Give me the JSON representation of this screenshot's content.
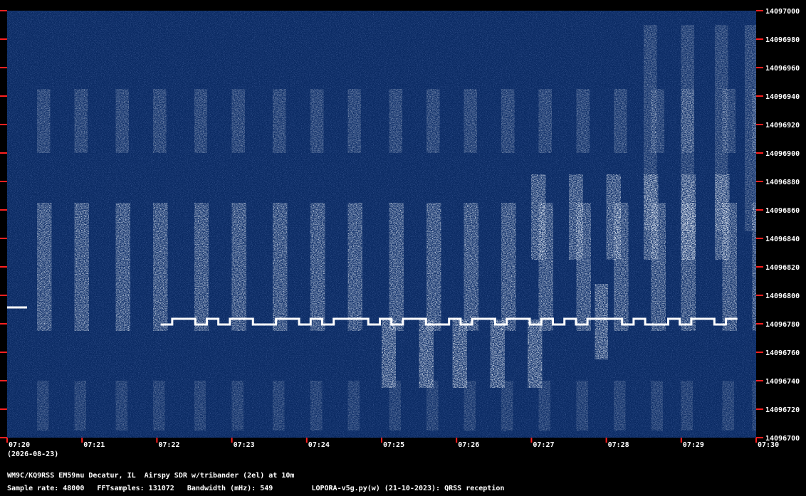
{
  "chart_data": {
    "type": "heatmap",
    "x_ticks": [
      "07:20",
      "07:21",
      "07:22",
      "07:23",
      "07:24",
      "07:25",
      "07:26",
      "07:27",
      "07:28",
      "07:29",
      "07:30"
    ],
    "date_label": "(2026-08-23)",
    "y_ticks": [
      14097000,
      14096980,
      14096960,
      14096940,
      14096920,
      14096900,
      14096880,
      14096860,
      14096840,
      14096820,
      14096800,
      14096780,
      14096760,
      14096740,
      14096720,
      14096700
    ],
    "ylim": [
      14096700,
      14097000
    ],
    "colors": {
      "background": "#0a2a63",
      "signal": "#ffffff",
      "tick": "#ff2020",
      "label": "#ffffff"
    },
    "grid": false
  },
  "info": {
    "line1": "WM9C/KQ9RSS EM59nu Decatur, IL  Airspy SDR w/tribander (2el) at 10m",
    "line2": "Sample rate: 48000   FFTsamples: 131072   Bandwidth (mHz): 549         LOPORA-v5g.py(w) (21-10-2023): QRSS reception"
  }
}
